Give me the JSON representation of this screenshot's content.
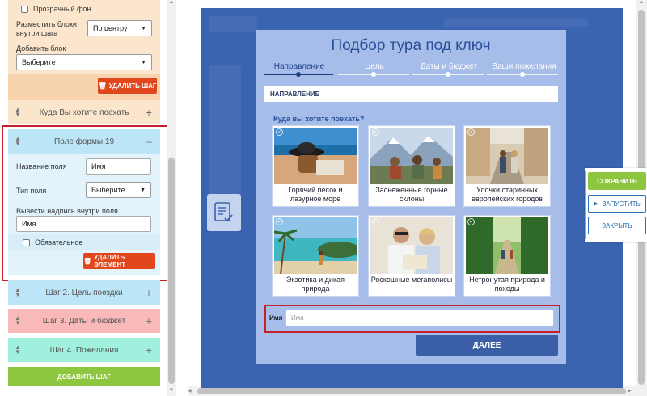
{
  "left": {
    "transparent_bg": "Прозрачный фон",
    "arrange_label": "Разместить блоки внутри шага",
    "arrange_value": "По центру",
    "add_block_label": "Добавить блок",
    "add_block_value": "Выберите",
    "delete_step": "УДАЛИТЬ ШАГ",
    "step1_title": "Куда Вы хотите поехать",
    "field_block_title": "Поле формы 19",
    "field_name_label": "Название поля",
    "field_name_value": "Имя",
    "field_type_label": "Тип поля",
    "field_type_value": "Выберите",
    "inside_label": "Вывести надпись внутри поля",
    "inside_value": "Имя",
    "required": "Обязательное",
    "delete_element": "УДАЛИТЬ ЭЛЕМЕНТ",
    "step2": "Шаг 2. Цель поездки",
    "step3": "Шаг 3. Даты и бюджет",
    "step4": "Шаг 4. Пожелания",
    "add_step": "ДОБАВИТЬ ШАГ"
  },
  "form": {
    "title": "Подбор тура под ключ",
    "tabs": [
      "Направление",
      "Цель",
      "Даты и бюджет",
      "Ваши пожелания"
    ],
    "section": "НАПРАВЛЕНИЕ",
    "question": "Куда вы хотите поехать?",
    "options": [
      {
        "caption": "Горячий песок и лазурное море",
        "icon": "beach-hat"
      },
      {
        "caption": "Заснеженные горные склоны",
        "icon": "mountains"
      },
      {
        "caption": "Улочки старинных европейских городов",
        "icon": "old-street"
      },
      {
        "caption": "Экзотика и дикая природа",
        "icon": "tropical-lagoon"
      },
      {
        "caption": "Роскошные мегаполисы",
        "icon": "city-couple"
      },
      {
        "caption": "Нетронутая природа и походы",
        "icon": "forest-path"
      }
    ],
    "name_label": "Имя",
    "name_placeholder": "Имя",
    "next": "ДАЛЕЕ"
  },
  "actions": {
    "save": "СОХРАНИТЬ",
    "run": "ЗАПУСТИТЬ",
    "close": "ЗАКРЫТЬ"
  },
  "colors": {
    "accent_blue": "#3a63b0",
    "delete_red": "#e2461c",
    "save_green": "#8dc63f",
    "highlight_red": "#c8202a"
  }
}
